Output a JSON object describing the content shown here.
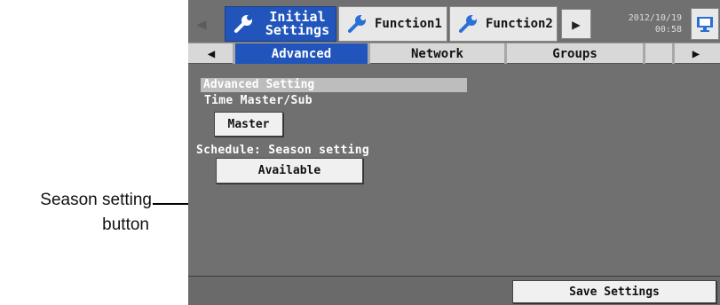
{
  "callout": {
    "line1": "Season setting",
    "line2": "button"
  },
  "top_tabs": {
    "initial_line1": "Initial",
    "initial_line2": "Settings",
    "function1": "Function1",
    "function2": "Function2"
  },
  "clock": {
    "date": "2012/10/19",
    "time": "00:58"
  },
  "sub_tabs": {
    "advanced": "Advanced",
    "network": "Network",
    "groups": "Groups"
  },
  "content": {
    "section_title": "Advanced Setting",
    "time_master_label": "Time Master/Sub",
    "time_master_button": "Master",
    "season_label": "Schedule: Season setting",
    "season_button": "Available"
  },
  "footer": {
    "save_button": "Save Settings"
  },
  "colors": {
    "active_tab": "#2255bb",
    "screen_bg": "#707070",
    "button_bg": "#f0f0f0"
  },
  "icons": [
    "wrench-icon",
    "left-arrow-icon",
    "right-arrow-icon",
    "play-icon",
    "monitor-icon"
  ]
}
